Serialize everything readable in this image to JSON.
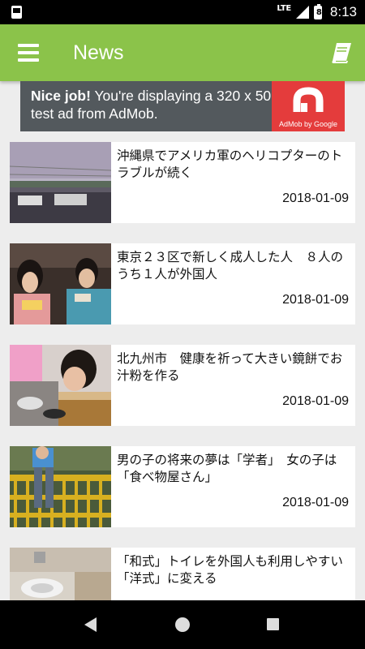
{
  "status_bar": {
    "network": "LTE",
    "battery_level": "8",
    "time": "8:13"
  },
  "app_bar": {
    "title": "News",
    "menu_icon": "hamburger-menu-icon",
    "action_icon": "book-icon",
    "color": "#8bc34a"
  },
  "ad": {
    "headline": "Nice job!",
    "body": " You're displaying a 320 x 50 test ad from AdMob.",
    "logo_caption": "AdMob by Google"
  },
  "news": [
    {
      "title": "沖縄県でアメリカ軍のヘリコプターのトラブルが続く",
      "date": "2018-01-09"
    },
    {
      "title": "東京２３区で新しく成人した人　８人のうち１人が外国人",
      "date": "2018-01-09"
    },
    {
      "title": "北九州市　健康を祈って大きい鏡餅でお汁粉を作る",
      "date": "2018-01-09"
    },
    {
      "title": "男の子の将来の夢は「学者」　女の子は「食べ物屋さん」",
      "date": "2018-01-09"
    },
    {
      "title": "「和式」トイレを外国人も利用しやすい「洋式」に変える",
      "date": ""
    }
  ],
  "nav_bar": {
    "back_icon": "back-triangle-icon",
    "home_icon": "home-circle-icon",
    "recents_icon": "recents-square-icon"
  }
}
